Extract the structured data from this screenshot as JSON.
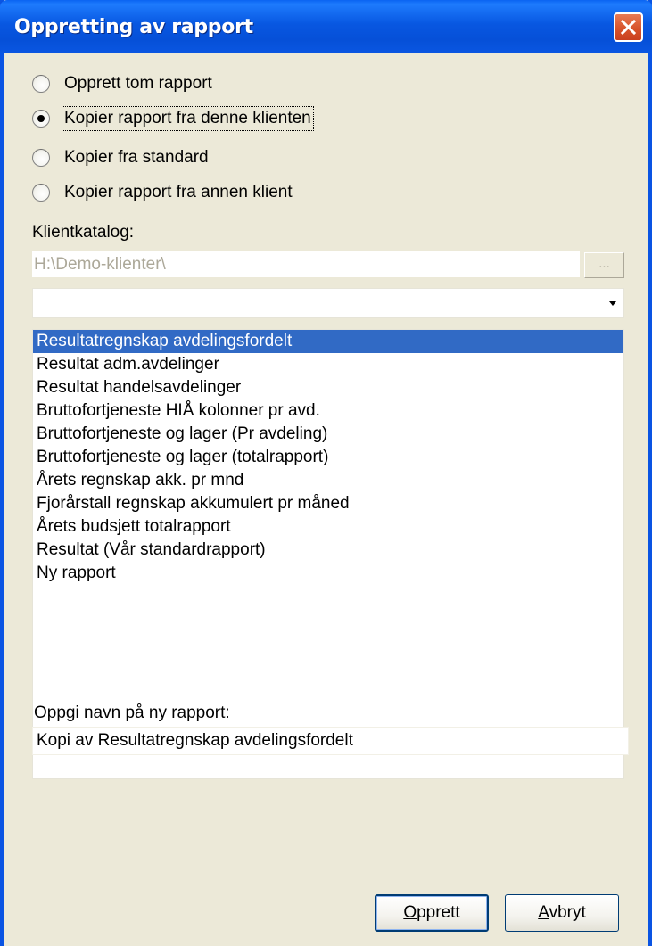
{
  "window": {
    "title": "Oppretting av rapport",
    "accent_color": "#0a54e3",
    "close_icon": "close-icon"
  },
  "options": [
    {
      "label": "Opprett tom rapport",
      "checked": false
    },
    {
      "label": "Kopier rapport fra denne klienten",
      "checked": true
    },
    {
      "label": "Kopier fra standard",
      "checked": false
    },
    {
      "label": "Kopier rapport fra annen klient",
      "checked": false
    }
  ],
  "client_catalog": {
    "label": "Klientkatalog:",
    "path_value": "H:\\Demo-klienter\\",
    "browse_label": "...",
    "combo_value": ""
  },
  "reports": {
    "selected_index": 0,
    "items": [
      "Resultatregnskap avdelingsfordelt",
      "Resultat adm.avdelinger",
      "Resultat handelsavdelinger",
      "Bruttofortjeneste HIÅ kolonner pr avd.",
      "Bruttofortjeneste og lager (Pr avdeling)",
      "Bruttofortjeneste og lager (totalrapport)",
      "Årets regnskap akk. pr mnd",
      "Fjorårstall regnskap akkumulert pr måned",
      "Årets budsjett totalrapport",
      "Resultat (Vår standardrapport)",
      "Ny rapport"
    ]
  },
  "new_name": {
    "label": "Oppgi navn på ny rapport:",
    "value": "Kopi av Resultatregnskap avdelingsfordelt"
  },
  "buttons": {
    "create": {
      "mnemonic": "O",
      "rest": "pprett"
    },
    "cancel": {
      "mnemonic": "A",
      "rest": "vbryt"
    }
  }
}
